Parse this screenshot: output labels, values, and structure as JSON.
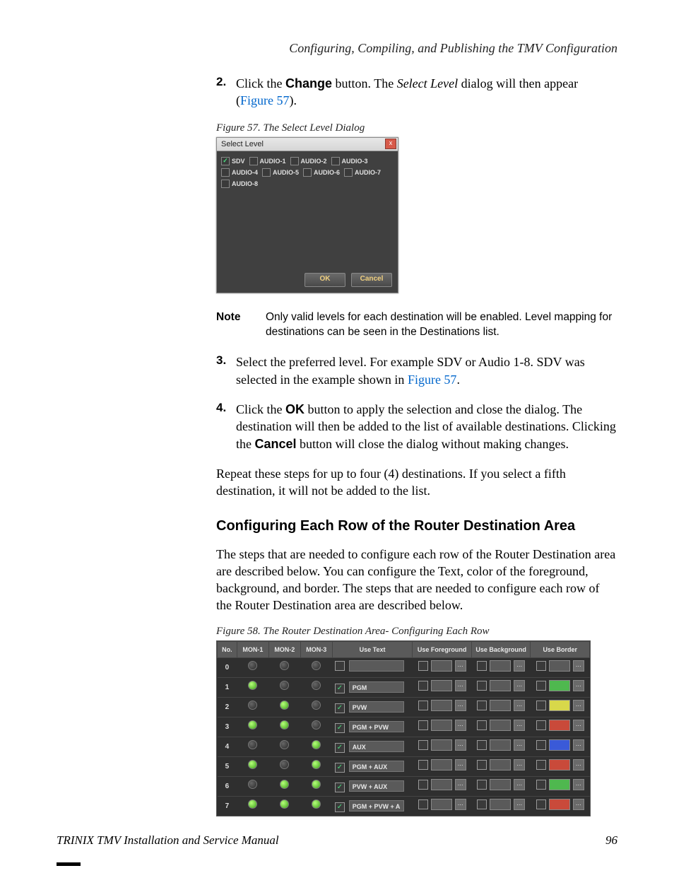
{
  "running_head": "Configuring, Compiling, and Publishing the TMV Configuration",
  "step2": {
    "num": "2.",
    "pre": "Click the ",
    "btn": "Change",
    "mid": " button. The ",
    "dlg": "Select Level",
    "post1": " dialog will then appear (",
    "link": "Figure 57",
    "post2": ")."
  },
  "fig57": {
    "caption": "Figure 57.  The Select Level Dialog",
    "title": "Select Level",
    "close_glyph": "x",
    "levels": [
      {
        "label": "SDV",
        "checked": true
      },
      {
        "label": "AUDIO-1",
        "checked": false
      },
      {
        "label": "AUDIO-2",
        "checked": false
      },
      {
        "label": "AUDIO-3",
        "checked": false
      },
      {
        "label": "AUDIO-4",
        "checked": false
      },
      {
        "label": "AUDIO-5",
        "checked": false
      },
      {
        "label": "AUDIO-6",
        "checked": false
      },
      {
        "label": "AUDIO-7",
        "checked": false
      },
      {
        "label": "AUDIO-8",
        "checked": false
      }
    ],
    "ok": "OK",
    "cancel": "Cancel"
  },
  "note": {
    "label": "Note",
    "text": "Only valid levels for each destination will be enabled. Level mapping for destinations can be seen in the Destinations list."
  },
  "step3": {
    "num": "3.",
    "pre": "Select the preferred level. For example SDV or Audio 1-8. SDV was selected in the example shown in ",
    "link": "Figure 57",
    "post": "."
  },
  "step4": {
    "num": "4.",
    "pre": "Click the ",
    "ok": "OK",
    "mid": " button to apply the selection and close the dialog. The destination will then be added to the list of available destinations. Clicking the ",
    "cancel": "Cancel",
    "post": " button will close the dialog without making changes."
  },
  "repeat_para": "Repeat these steps for up to four (4) destinations. If you select a fifth destination, it will not be added to the list.",
  "h3": "Configuring Each Row of the Router Destination Area",
  "config_para": "The steps that are needed to configure each row of the Router Destination area are described below. You can configure the Text, color of the foreground, background, and border. The steps that are needed to configure each row of the Router Destination area are described below.",
  "fig58": {
    "caption": "Figure 58.  The Router Destination Area- Configuring Each Row",
    "headers": {
      "no": "No.",
      "mon1": "MON-1",
      "mon2": "MON-2",
      "mon3": "MON-3",
      "usetext": "Use Text",
      "usefg": "Use Foreground",
      "usebg": "Use Background",
      "useborder": "Use Border"
    },
    "check_glyph": "✓",
    "ellipsis": "…",
    "rows": [
      {
        "no": "0",
        "mon": [
          false,
          false,
          false
        ],
        "usetext": false,
        "text": "",
        "border": "#5a5a5a"
      },
      {
        "no": "1",
        "mon": [
          true,
          false,
          false
        ],
        "usetext": true,
        "text": "PGM",
        "border": "#4fb84f"
      },
      {
        "no": "2",
        "mon": [
          false,
          true,
          false
        ],
        "usetext": true,
        "text": "PVW",
        "border": "#d8d84a"
      },
      {
        "no": "3",
        "mon": [
          true,
          true,
          false
        ],
        "usetext": true,
        "text": "PGM + PVW",
        "border": "#c94a3a"
      },
      {
        "no": "4",
        "mon": [
          false,
          false,
          true
        ],
        "usetext": true,
        "text": "AUX",
        "border": "#3a5ad8"
      },
      {
        "no": "5",
        "mon": [
          true,
          false,
          true
        ],
        "usetext": true,
        "text": "PGM + AUX",
        "border": "#c94a3a"
      },
      {
        "no": "6",
        "mon": [
          false,
          true,
          true
        ],
        "usetext": true,
        "text": "PVW + AUX",
        "border": "#4fb84f"
      },
      {
        "no": "7",
        "mon": [
          true,
          true,
          true
        ],
        "usetext": true,
        "text": "PGM + PVW + A",
        "border": "#c94a3a"
      }
    ]
  },
  "footer_left": "TRINIX TMV Installation and Service Manual",
  "footer_right": "96"
}
